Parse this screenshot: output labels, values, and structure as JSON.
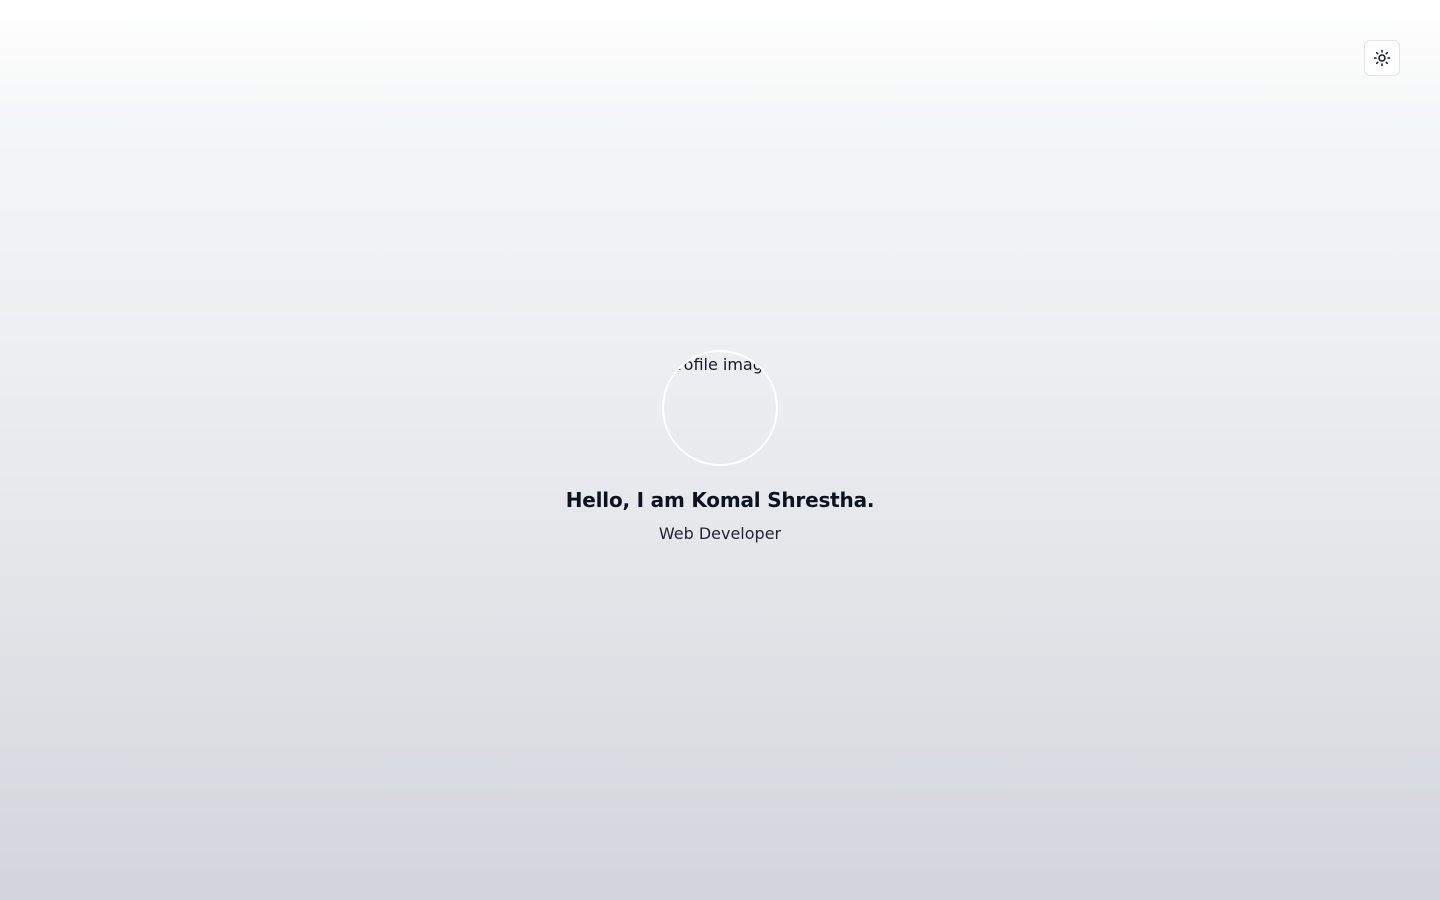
{
  "header": {
    "theme_toggle": {
      "icon": "sun-icon"
    }
  },
  "hero": {
    "avatar_alt": "profile image",
    "headline": "Hello, I am Komal Shrestha.",
    "subtitle": "Web Developer"
  },
  "colors": {
    "background_top": "#ffffff",
    "background_bottom": "#d2d5dc",
    "text_primary": "#0b1222",
    "avatar_border": "#ffffff"
  }
}
